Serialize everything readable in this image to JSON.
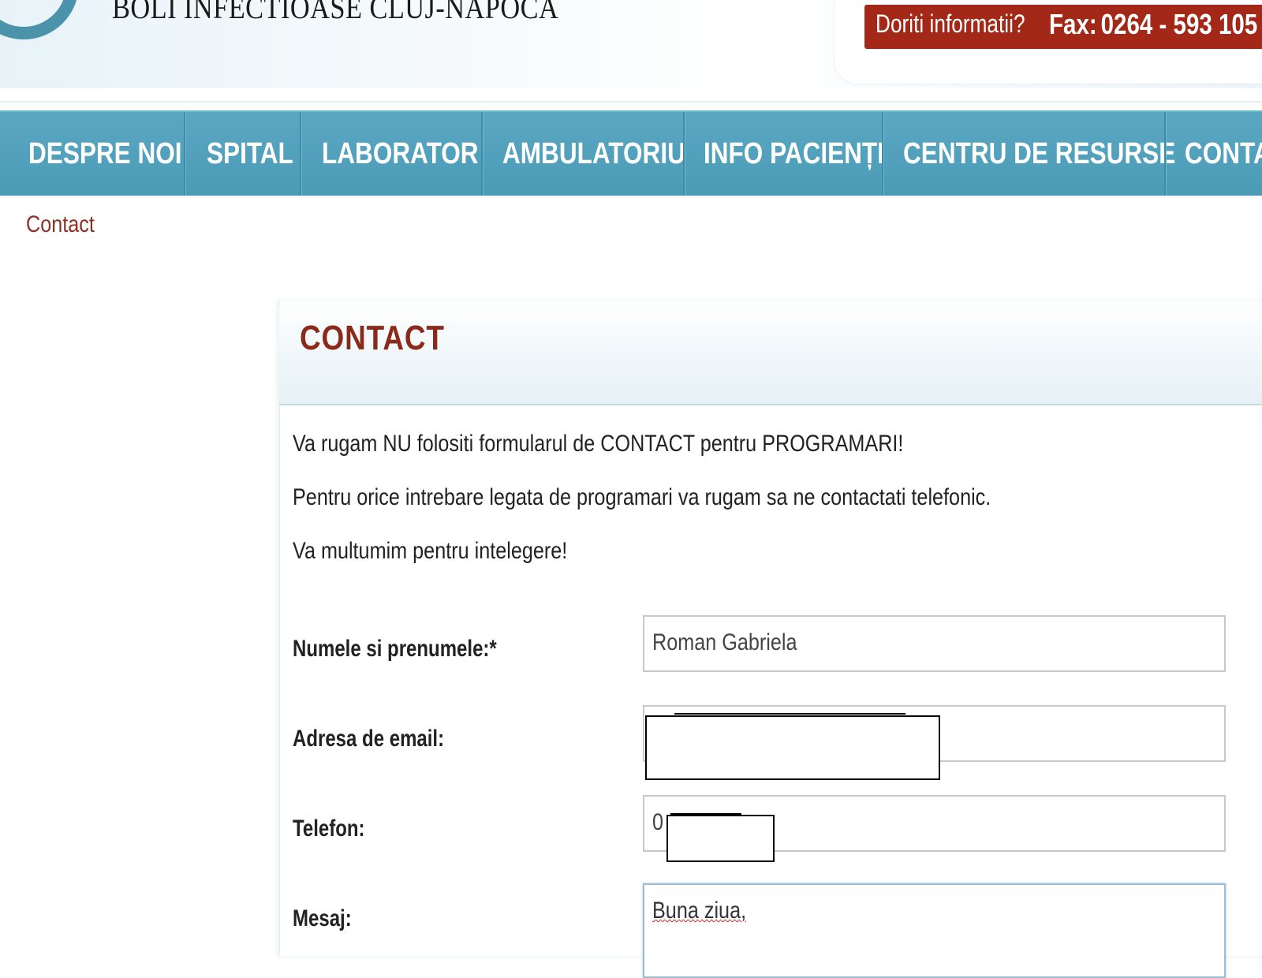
{
  "header": {
    "site_title": "BOLI INFECTIOASE CLUJ-NAPOCA",
    "info_label": "Doriti informatii?",
    "fax_label": "Fax:",
    "fax_number": "0264 - 593 105"
  },
  "nav": {
    "items": [
      {
        "label": "DESPRE NOI"
      },
      {
        "label": "SPITAL"
      },
      {
        "label": "LABORATOR"
      },
      {
        "label": "AMBULATORIU"
      },
      {
        "label": "INFO PACIENȚI"
      },
      {
        "label": "CENTRU DE RESURSE"
      },
      {
        "label": "CONTA"
      }
    ]
  },
  "breadcrumb": "Contact",
  "panel": {
    "title": "CONTACT",
    "notices": [
      "Va rugam NU folositi formularul de CONTACT pentru PROGRAMARI!",
      "Pentru orice intrebare legata de programari va rugam sa ne contactati telefonic.",
      "Va multumim pentru intelegere!"
    ]
  },
  "form": {
    "name_label": "Numele si prenumele:*",
    "name_value": "Roman Gabriela",
    "email_label": "Adresa de email:",
    "email_value": "",
    "phone_label": "Telefon:",
    "phone_value": "0",
    "message_label": "Mesaj:",
    "message_value": "Buna ziua,"
  },
  "colors": {
    "nav_blue": "#4b9bb7",
    "info_red": "#a32817",
    "title_red": "#8b2a1a"
  }
}
